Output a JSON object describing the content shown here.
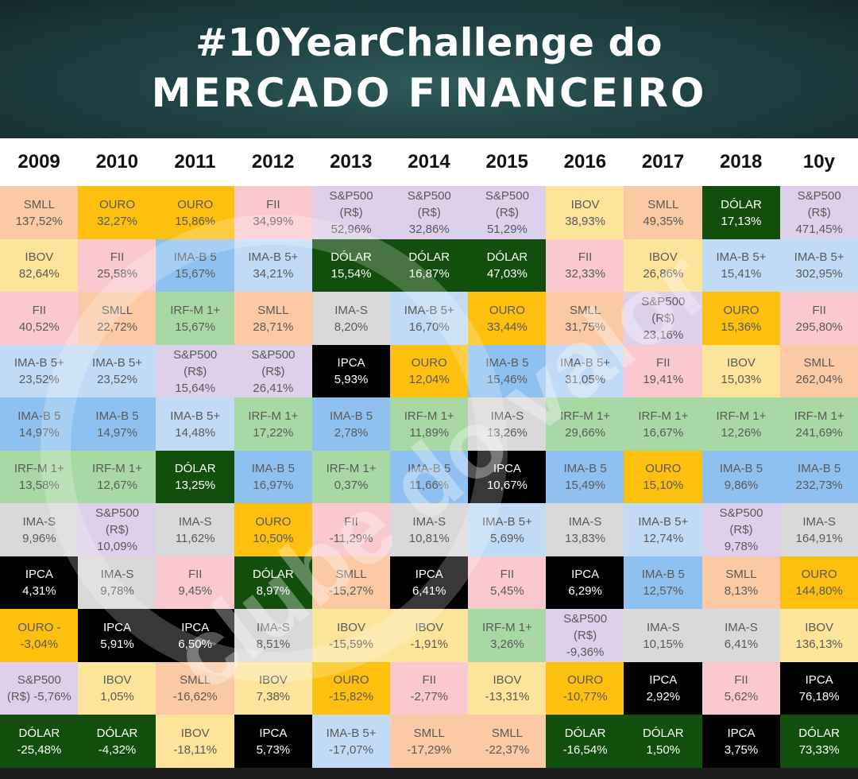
{
  "title": {
    "line1": "#10YearChallenge do",
    "line2": "MERCADO FINANCEIRO"
  },
  "watermark": "clube do valor",
  "colors": {
    "SMLL": "#fbc9a4",
    "OURO": "#fdc00f",
    "FII": "#fac9cf",
    "S&P500": "#dcd0ea",
    "DÓLAR": "#134f0c",
    "IBOV": "#fde49b",
    "IMA-B 5+": "#c1daf6",
    "IMA-B 5": "#8fc1f0",
    "IRF-M 1+": "#a8d9a4",
    "IMA-S": "#d9d9d9",
    "IPCA": "#000000"
  },
  "dark_text_color": "#5a5a5a",
  "light_text_color": "#ffffff",
  "chart_data": {
    "type": "table",
    "columns": [
      "2009",
      "2010",
      "2011",
      "2012",
      "2013",
      "2014",
      "2015",
      "2016",
      "2017",
      "2018",
      "10y"
    ],
    "rows": [
      [
        {
          "asset": "SMLL",
          "lines": [
            "SMLL",
            "137,52%"
          ]
        },
        {
          "asset": "OURO",
          "lines": [
            "OURO",
            "32,27%"
          ]
        },
        {
          "asset": "OURO",
          "lines": [
            "OURO",
            "15,86%"
          ]
        },
        {
          "asset": "FII",
          "lines": [
            "FII",
            "34,99%"
          ]
        },
        {
          "asset": "S&P500",
          "lines": [
            "S&P500",
            "(R$)",
            "52,96%"
          ]
        },
        {
          "asset": "S&P500",
          "lines": [
            "S&P500",
            "(R$)",
            "32,86%"
          ]
        },
        {
          "asset": "S&P500",
          "lines": [
            "S&P500",
            "(R$)",
            "51,29%"
          ]
        },
        {
          "asset": "IBOV",
          "lines": [
            "IBOV",
            "38,93%"
          ]
        },
        {
          "asset": "SMLL",
          "lines": [
            "SMLL",
            "49,35%"
          ]
        },
        {
          "asset": "DÓLAR",
          "lines": [
            "DÓLAR",
            "17,13%"
          ]
        },
        {
          "asset": "S&P500",
          "lines": [
            "S&P500",
            "(R$)",
            "471,45%"
          ]
        }
      ],
      [
        {
          "asset": "IBOV",
          "lines": [
            "IBOV",
            "82,64%"
          ]
        },
        {
          "asset": "FII",
          "lines": [
            "FII",
            "25,58%"
          ]
        },
        {
          "asset": "IMA-B 5",
          "lines": [
            "IMA-B 5",
            "15,67%"
          ]
        },
        {
          "asset": "IMA-B 5+",
          "lines": [
            "IMA-B 5+",
            "34,21%"
          ]
        },
        {
          "asset": "DÓLAR",
          "lines": [
            "DÓLAR",
            "15,54%"
          ]
        },
        {
          "asset": "DÓLAR",
          "lines": [
            "DÓLAR",
            "16,87%"
          ]
        },
        {
          "asset": "DÓLAR",
          "lines": [
            "DÓLAR",
            "47,03%"
          ]
        },
        {
          "asset": "FII",
          "lines": [
            "FII",
            "32,33%"
          ]
        },
        {
          "asset": "IBOV",
          "lines": [
            "IBOV",
            "26,86%"
          ]
        },
        {
          "asset": "IMA-B 5+",
          "lines": [
            "IMA-B 5+",
            "15,41%"
          ]
        },
        {
          "asset": "IMA-B 5+",
          "lines": [
            "IMA-B 5+",
            "302,95%"
          ]
        }
      ],
      [
        {
          "asset": "FII",
          "lines": [
            "FII",
            "40,52%"
          ]
        },
        {
          "asset": "SMLL",
          "lines": [
            "SMLL",
            "22,72%"
          ]
        },
        {
          "asset": "IRF-M 1+",
          "lines": [
            "IRF-M 1+",
            "15,67%"
          ]
        },
        {
          "asset": "SMLL",
          "lines": [
            "SMLL",
            "28,71%"
          ]
        },
        {
          "asset": "IMA-S",
          "lines": [
            "IMA-S",
            "8,20%"
          ]
        },
        {
          "asset": "IMA-B 5+",
          "lines": [
            "IMA-B 5+",
            "16,70%"
          ]
        },
        {
          "asset": "OURO",
          "lines": [
            "OURO",
            "33,44%"
          ]
        },
        {
          "asset": "SMLL",
          "lines": [
            "SMLL",
            "31,75%"
          ]
        },
        {
          "asset": "S&P500",
          "lines": [
            "S&P500",
            "(R$)",
            "23,16%"
          ]
        },
        {
          "asset": "OURO",
          "lines": [
            "OURO",
            "15,36%"
          ]
        },
        {
          "asset": "FII",
          "lines": [
            "FII",
            "295,80%"
          ]
        }
      ],
      [
        {
          "asset": "IMA-B 5+",
          "lines": [
            "IMA-B 5+",
            "23,52%"
          ]
        },
        {
          "asset": "IMA-B 5+",
          "lines": [
            "IMA-B 5+",
            "23,52%"
          ]
        },
        {
          "asset": "S&P500",
          "lines": [
            "S&P500",
            "(R$)",
            "15,64%"
          ]
        },
        {
          "asset": "S&P500",
          "lines": [
            "S&P500",
            "(R$)",
            "26,41%"
          ]
        },
        {
          "asset": "IPCA",
          "lines": [
            "IPCA",
            "5,93%"
          ]
        },
        {
          "asset": "OURO",
          "lines": [
            "OURO",
            "12,04%"
          ]
        },
        {
          "asset": "IMA-B 5",
          "lines": [
            "IMA-B 5",
            "15,46%"
          ]
        },
        {
          "asset": "IMA-B 5+",
          "lines": [
            "IMA-B 5+",
            "31,05%"
          ]
        },
        {
          "asset": "FII",
          "lines": [
            "FII",
            "19,41%"
          ]
        },
        {
          "asset": "IBOV",
          "lines": [
            "IBOV",
            "15,03%"
          ]
        },
        {
          "asset": "SMLL",
          "lines": [
            "SMLL",
            "262,04%"
          ]
        }
      ],
      [
        {
          "asset": "IMA-B 5",
          "lines": [
            "IMA-B 5",
            "14,97%"
          ]
        },
        {
          "asset": "IMA-B 5",
          "lines": [
            "IMA-B 5",
            "14,97%"
          ]
        },
        {
          "asset": "IMA-B 5+",
          "lines": [
            "IMA-B 5+",
            "14,48%"
          ]
        },
        {
          "asset": "IRF-M 1+",
          "lines": [
            "IRF-M 1+",
            "17,22%"
          ]
        },
        {
          "asset": "IMA-B 5",
          "lines": [
            "IMA-B 5",
            "2,78%"
          ]
        },
        {
          "asset": "IRF-M 1+",
          "lines": [
            "IRF-M 1+",
            "11,89%"
          ]
        },
        {
          "asset": "IMA-S",
          "lines": [
            "IMA-S",
            "13,26%"
          ]
        },
        {
          "asset": "IRF-M 1+",
          "lines": [
            "IRF-M 1+",
            "29,66%"
          ]
        },
        {
          "asset": "IRF-M 1+",
          "lines": [
            "IRF-M 1+",
            "16,67%"
          ]
        },
        {
          "asset": "IRF-M 1+",
          "lines": [
            "IRF-M 1+",
            "12,26%"
          ]
        },
        {
          "asset": "IRF-M 1+",
          "lines": [
            "IRF-M 1+",
            "241,69%"
          ]
        }
      ],
      [
        {
          "asset": "IRF-M 1+",
          "lines": [
            "IRF-M 1+",
            "13,58%"
          ]
        },
        {
          "asset": "IRF-M 1+",
          "lines": [
            "IRF-M 1+",
            "12,67%"
          ]
        },
        {
          "asset": "DÓLAR",
          "lines": [
            "DÓLAR",
            "13,25%"
          ]
        },
        {
          "asset": "IMA-B 5",
          "lines": [
            "IMA-B 5",
            "16,97%"
          ]
        },
        {
          "asset": "IRF-M 1+",
          "lines": [
            "IRF-M 1+",
            "0,37%"
          ]
        },
        {
          "asset": "IMA-B 5",
          "lines": [
            "IMA-B 5",
            "11,66%"
          ]
        },
        {
          "asset": "IPCA",
          "lines": [
            "IPCA",
            "10,67%"
          ]
        },
        {
          "asset": "IMA-B 5",
          "lines": [
            "IMA-B 5",
            "15,49%"
          ]
        },
        {
          "asset": "OURO",
          "lines": [
            "OURO",
            "15,10%"
          ]
        },
        {
          "asset": "IMA-B 5",
          "lines": [
            "IMA-B 5",
            "9,86%"
          ]
        },
        {
          "asset": "IMA-B 5",
          "lines": [
            "IMA-B 5",
            "232,73%"
          ]
        }
      ],
      [
        {
          "asset": "IMA-S",
          "lines": [
            "IMA-S",
            "9,96%"
          ]
        },
        {
          "asset": "S&P500",
          "lines": [
            "S&P500",
            "(R$)",
            "10,09%"
          ]
        },
        {
          "asset": "IMA-S",
          "lines": [
            "IMA-S",
            "11,62%"
          ]
        },
        {
          "asset": "OURO",
          "lines": [
            "OURO",
            "10,50%"
          ]
        },
        {
          "asset": "FII",
          "lines": [
            "FII",
            "-11,29%"
          ]
        },
        {
          "asset": "IMA-S",
          "lines": [
            "IMA-S",
            "10,81%"
          ]
        },
        {
          "asset": "IMA-B 5+",
          "lines": [
            "IMA-B 5+",
            "5,69%"
          ]
        },
        {
          "asset": "IMA-S",
          "lines": [
            "IMA-S",
            "13,83%"
          ]
        },
        {
          "asset": "IMA-B 5+",
          "lines": [
            "IMA-B 5+",
            "12,74%"
          ]
        },
        {
          "asset": "S&P500",
          "lines": [
            "S&P500",
            "(R$)",
            "9,78%"
          ]
        },
        {
          "asset": "IMA-S",
          "lines": [
            "IMA-S",
            "164,91%"
          ]
        }
      ],
      [
        {
          "asset": "IPCA",
          "lines": [
            "IPCA",
            "4,31%"
          ]
        },
        {
          "asset": "IMA-S",
          "lines": [
            "IMA-S",
            "9,78%"
          ]
        },
        {
          "asset": "FII",
          "lines": [
            "FII",
            "9,45%"
          ]
        },
        {
          "asset": "DÓLAR",
          "lines": [
            "DÓLAR",
            "8,97%"
          ]
        },
        {
          "asset": "SMLL",
          "lines": [
            "SMLL",
            "-15,27%"
          ]
        },
        {
          "asset": "IPCA",
          "lines": [
            "IPCA",
            "6,41%"
          ]
        },
        {
          "asset": "FII",
          "lines": [
            "FII",
            "5,45%"
          ]
        },
        {
          "asset": "IPCA",
          "lines": [
            "IPCA",
            "6,29%"
          ]
        },
        {
          "asset": "IMA-B 5",
          "lines": [
            "IMA-B 5",
            "12,57%"
          ]
        },
        {
          "asset": "SMLL",
          "lines": [
            "SMLL",
            "8,13%"
          ]
        },
        {
          "asset": "OURO",
          "lines": [
            "OURO",
            "144,80%"
          ]
        }
      ],
      [
        {
          "asset": "OURO",
          "lines": [
            "OURO -",
            "-3,04%"
          ]
        },
        {
          "asset": "IPCA",
          "lines": [
            "IPCA",
            "5,91%"
          ]
        },
        {
          "asset": "IPCA",
          "lines": [
            "IPCA",
            "6,50%"
          ]
        },
        {
          "asset": "IMA-S",
          "lines": [
            "IMA-S",
            "8,51%"
          ]
        },
        {
          "asset": "IBOV",
          "lines": [
            "IBOV",
            "-15,59%"
          ]
        },
        {
          "asset": "IBOV",
          "lines": [
            "IBOV",
            "-1,91%"
          ]
        },
        {
          "asset": "IRF-M 1+",
          "lines": [
            "IRF-M 1+",
            "3,26%"
          ]
        },
        {
          "asset": "S&P500",
          "lines": [
            "S&P500",
            "(R$)",
            "-9,36%"
          ]
        },
        {
          "asset": "IMA-S",
          "lines": [
            "IMA-S",
            "10,15%"
          ]
        },
        {
          "asset": "IMA-S",
          "lines": [
            "IMA-S",
            "6,41%"
          ]
        },
        {
          "asset": "IBOV",
          "lines": [
            "IBOV",
            "136,13%"
          ]
        }
      ],
      [
        {
          "asset": "S&P500",
          "lines": [
            "S&P500",
            "(R$) -5,76%"
          ]
        },
        {
          "asset": "IBOV",
          "lines": [
            "IBOV",
            "1,05%"
          ]
        },
        {
          "asset": "SMLL",
          "lines": [
            "SMLL",
            "-16,62%"
          ]
        },
        {
          "asset": "IBOV",
          "lines": [
            "IBOV",
            "7,38%"
          ]
        },
        {
          "asset": "OURO",
          "lines": [
            "OURO",
            "-15,82%"
          ]
        },
        {
          "asset": "FII",
          "lines": [
            "FII",
            "-2,77%"
          ]
        },
        {
          "asset": "IBOV",
          "lines": [
            "IBOV",
            "-13,31%"
          ]
        },
        {
          "asset": "OURO",
          "lines": [
            "OURO",
            "-10,77%"
          ]
        },
        {
          "asset": "IPCA",
          "lines": [
            "IPCA",
            "2,92%"
          ]
        },
        {
          "asset": "FII",
          "lines": [
            "FII",
            "5,62%"
          ]
        },
        {
          "asset": "IPCA",
          "lines": [
            "IPCA",
            "76,18%"
          ]
        }
      ],
      [
        {
          "asset": "DÓLAR",
          "lines": [
            "DÓLAR",
            "-25,48%"
          ]
        },
        {
          "asset": "DÓLAR",
          "lines": [
            "DÓLAR",
            "-4,32%"
          ]
        },
        {
          "asset": "IBOV",
          "lines": [
            "IBOV",
            "-18,11%"
          ]
        },
        {
          "asset": "IPCA",
          "lines": [
            "IPCA",
            "5,73%"
          ]
        },
        {
          "asset": "IMA-B 5+",
          "lines": [
            "IMA-B 5+",
            "-17,07%"
          ]
        },
        {
          "asset": "SMLL",
          "lines": [
            "SMLL",
            "-17,29%"
          ]
        },
        {
          "asset": "SMLL",
          "lines": [
            "SMLL",
            "-22,37%"
          ]
        },
        {
          "asset": "DÓLAR",
          "lines": [
            "DÓLAR",
            "-16,54%"
          ]
        },
        {
          "asset": "DÓLAR",
          "lines": [
            "DÓLAR",
            "1,50%"
          ]
        },
        {
          "asset": "IPCA",
          "lines": [
            "IPCA",
            "3,75%"
          ]
        },
        {
          "asset": "DÓLAR",
          "lines": [
            "DÓLAR",
            "73,33%"
          ]
        }
      ]
    ]
  }
}
